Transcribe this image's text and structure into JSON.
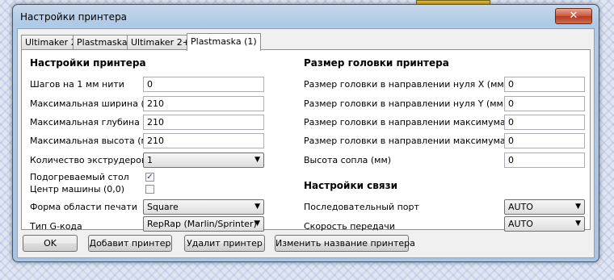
{
  "window": {
    "title": "Настройки принтера",
    "close_glyph": "✕"
  },
  "tabs": [
    {
      "label": "Ultimaker 2"
    },
    {
      "label": "Plastmaska"
    },
    {
      "label": "Ultimaker 2+"
    },
    {
      "label": "Plastmaska (1)"
    }
  ],
  "printer_settings": {
    "title": "Настройки принтера",
    "steps_label": "Шагов на 1 мм нити",
    "steps_value": "0",
    "width_label": "Максимальная ширина (мм)",
    "width_value": "210",
    "depth_label": "Максимальная глубина (мм)",
    "depth_value": "210",
    "height_label": "Максимальная высота (мм)",
    "height_value": "210",
    "extruders_label": "Количество экструдеров",
    "extruders_value": "1",
    "heated_bed_label": "Подогреваемый стол",
    "heated_bed_checked": true,
    "check_glyph": "✓",
    "center_label": "Центр машины (0,0)",
    "center_checked": false,
    "shape_label": "Форма области печати",
    "shape_value": "Square",
    "gcode_label": "Тип G-кода",
    "gcode_value": "RepRap (Marlin/Sprinter)"
  },
  "head_size": {
    "title": "Размер головки принтера",
    "xmin_label": "Размер головки в направлении нуля X (мм)",
    "xmin_value": "0",
    "ymin_label": "Размер головки в направлении нуля Y (мм)",
    "ymin_value": "0",
    "xmax_label": "Размер головки в направлении максимума X (мм)",
    "xmax_value": "0",
    "ymax_label": "Размер головки в направлении максимума Y (мм)",
    "ymax_value": "0",
    "nozzle_label": "Высота сопла (мм)",
    "nozzle_value": "0"
  },
  "communication": {
    "title": "Настройки связи",
    "port_label": "Последовательный порт",
    "port_value": "AUTO",
    "baud_label": "Скорость передачи",
    "baud_value": "AUTO"
  },
  "buttons": {
    "ok": "OK",
    "add_printer": "Добавит принтер",
    "remove_printer": "Удалит принтер",
    "rename_printer": "Изменить название принтера"
  },
  "dropdown_arrow": "▼"
}
